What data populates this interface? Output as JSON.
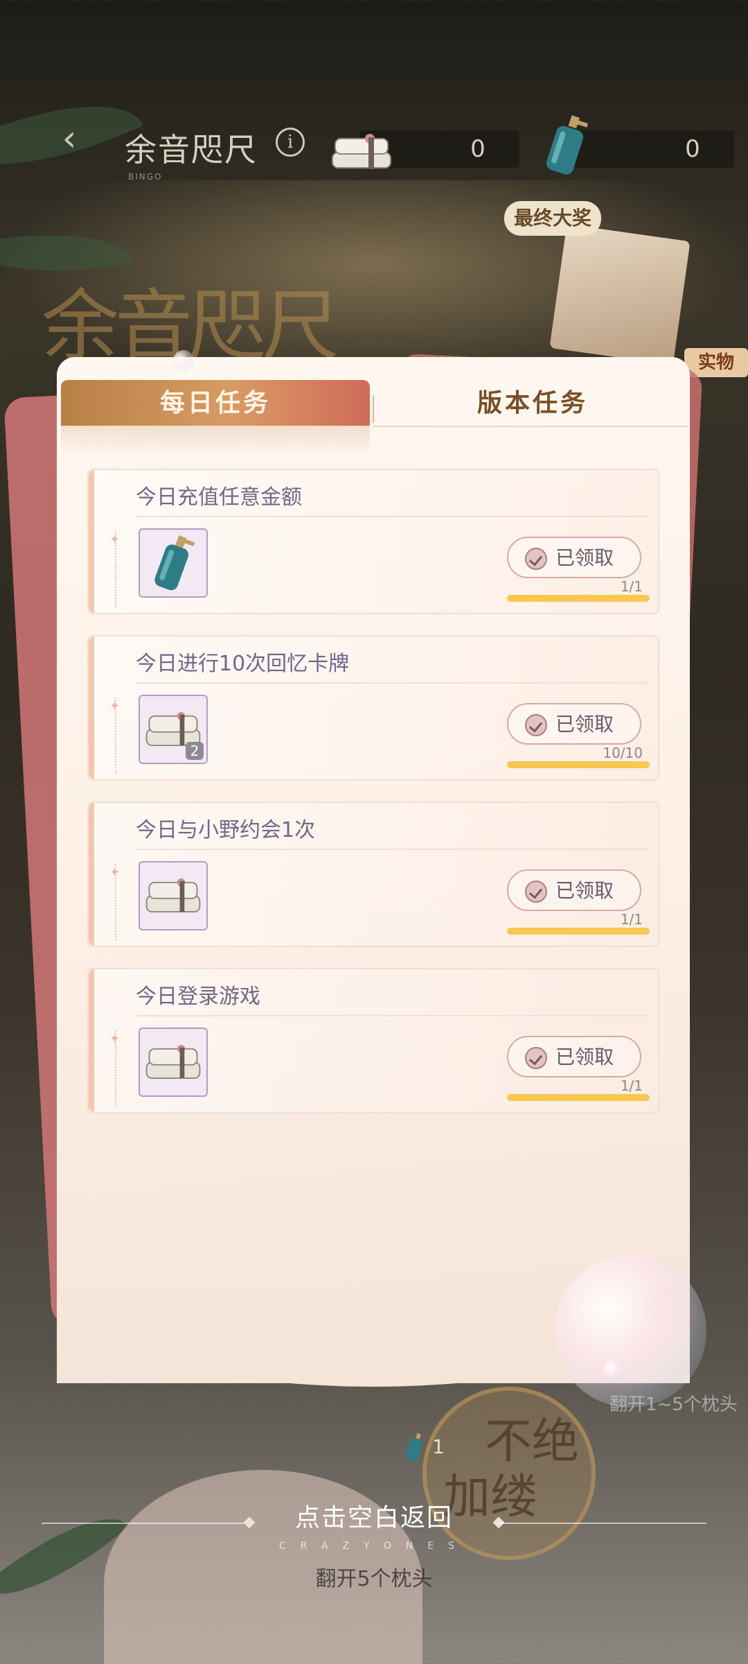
{
  "header": {
    "title": "余音咫尺",
    "title_sub": "BINGO",
    "towel_count": "0",
    "bottle_count": "0"
  },
  "banner": {
    "text": "余音咫尺",
    "grand_prize": "最终大奖",
    "real_tag": "实物"
  },
  "tabs": [
    {
      "label": "每日任务",
      "active": true
    },
    {
      "label": "版本任务",
      "active": false
    }
  ],
  "tasks": [
    {
      "title": "今日充值任意金额",
      "reward_icon": "bottle-icon",
      "reward_count": "",
      "claim_label": "已领取",
      "progress_text": "1/1",
      "progress": 1.0
    },
    {
      "title": "今日进行10次回忆卡牌",
      "reward_icon": "towel-icon",
      "reward_count": "2",
      "claim_label": "已领取",
      "progress_text": "10/10",
      "progress": 1.0
    },
    {
      "title": "今日与小野约会1次",
      "reward_icon": "towel-icon",
      "reward_count": "",
      "claim_label": "已领取",
      "progress_text": "1/1",
      "progress": 1.0
    },
    {
      "title": "今日登录游戏",
      "reward_icon": "towel-icon",
      "reward_count": "",
      "claim_label": "已领取",
      "progress_text": "1/1",
      "progress": 1.0
    }
  ],
  "bottom": {
    "flip_1_5": "翻开1~5个枕头",
    "coin_count": "1",
    "coin_text_1": "不绝",
    "coin_text_2": "加缕",
    "return_hint": "点击空白返回",
    "brand": "CRAZYONES",
    "flip_5": "翻开5个枕头"
  },
  "colors": {
    "tab_active": "#d89b65",
    "progress_fill": "#f7c750",
    "task_title": "#6e6889"
  }
}
